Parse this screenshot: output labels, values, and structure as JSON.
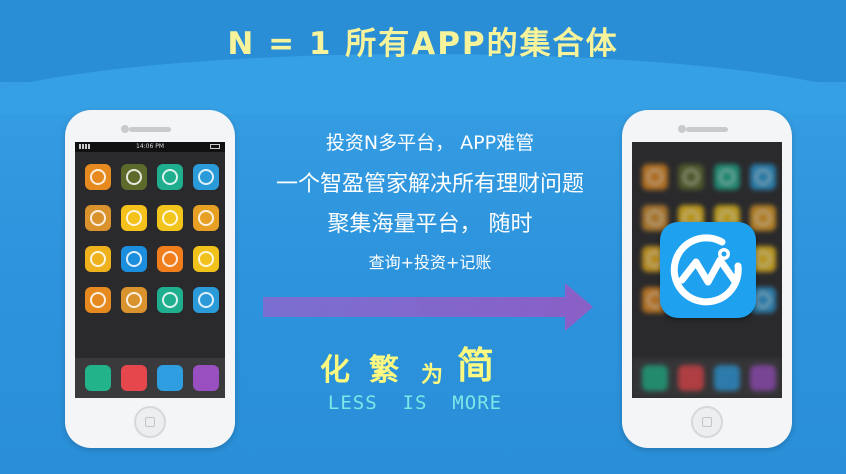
{
  "headline": "N = 1 所有APP的集合体",
  "lines": {
    "l1": "投资N多平台， APP难管",
    "l2": "一个智盈管家解决所有理财问题",
    "l3": "聚集海量平台， 随时",
    "l4": "查询+投资+记账"
  },
  "slogan": {
    "c1": "化",
    "c2": "繁",
    "c3": "为",
    "c4": "简",
    "english": "LESS  IS  MORE"
  },
  "phone_left": {
    "status_time": "14:06 PM",
    "apps": [
      {
        "icon": "gold-coin-app-icon",
        "color": "#e68a1f"
      },
      {
        "icon": "ancient-coin-app-icon",
        "color": "#5c6b2b"
      },
      {
        "icon": "handshake-app-icon",
        "color": "#1fae8e"
      },
      {
        "icon": "shield-app-icon",
        "color": "#2a9ad8"
      },
      {
        "icon": "lucky-seal-app-icon",
        "color": "#d9922c"
      },
      {
        "icon": "b-logo-app-icon",
        "color": "#f4c21a"
      },
      {
        "icon": "st-star-app-icon",
        "color": "#f2c51c"
      },
      {
        "icon": "square-seal-app-icon",
        "color": "#e8a024"
      },
      {
        "icon": "yuan-coin-app-icon",
        "color": "#f0b21c"
      },
      {
        "icon": "ring-app-icon",
        "color": "#1c8ede"
      },
      {
        "icon": "flower-app-icon",
        "color": "#f07e1c"
      },
      {
        "icon": "volleyball-app-icon",
        "color": "#f2c21c"
      },
      {
        "icon": "gold-coin-app-icon",
        "color": "#e68a1f"
      },
      {
        "icon": "lucky-seal-app-icon",
        "color": "#d9922c"
      },
      {
        "icon": "handshake-app-icon",
        "color": "#1fae8e"
      },
      {
        "icon": "shield-app-icon",
        "color": "#2a9ad8"
      }
    ],
    "dock": [
      {
        "icon": "phone-app-icon",
        "color": "#22b38a"
      },
      {
        "icon": "video-app-icon",
        "color": "#e6474c"
      },
      {
        "icon": "message-app-icon",
        "color": "#2f9ee0"
      },
      {
        "icon": "clock-app-icon",
        "color": "#9a4fc0"
      }
    ]
  },
  "phone_right": {
    "featured_icon": "wisdom-manager-app-icon",
    "featured_color": "#1ea1ef"
  },
  "colors": {
    "background": "#2f96de",
    "headline": "#f7f39a",
    "arrow": "#7b6fcf",
    "slogan": "#fbf97f",
    "english": "#7de7e6"
  }
}
